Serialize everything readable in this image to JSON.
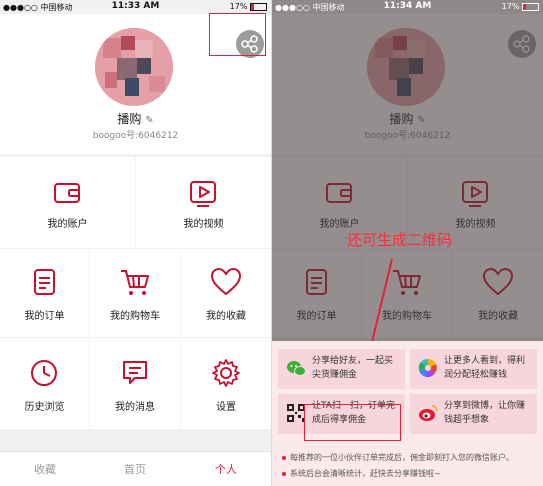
{
  "status_left": {
    "carrier": "●●●○○ 中国移动",
    "time": "11:33 AM",
    "battery": "17%"
  },
  "status_right": {
    "carrier": "●●●○○ 中国移动",
    "time": "11:34 AM",
    "battery": "17%"
  },
  "profile": {
    "nickname": "播购",
    "uid": "boogoo号:6046212"
  },
  "menu": [
    {
      "label": "我的账户",
      "icon": "wallet-icon"
    },
    {
      "label": "我的视频",
      "icon": "video-play-icon"
    },
    {
      "label": "我的订单",
      "icon": "order-document-icon"
    },
    {
      "label": "我的购物车",
      "icon": "shopping-cart-icon"
    },
    {
      "label": "我的收藏",
      "icon": "heart-icon"
    },
    {
      "label": "历史浏览",
      "icon": "clock-icon"
    },
    {
      "label": "我的消息",
      "icon": "message-icon"
    },
    {
      "label": "设置",
      "icon": "gear-icon"
    }
  ],
  "tabs": [
    {
      "label": "收藏",
      "active": false
    },
    {
      "label": "首页",
      "active": false
    },
    {
      "label": "个人",
      "active": true
    }
  ],
  "annotation": "还可生成二维码",
  "share_options": [
    {
      "text": "分享给好友，一起买尖货赚佣金",
      "icon": "wechat-icon"
    },
    {
      "text": "让更多人看到，得利润分配轻松赚钱",
      "icon": "moments-icon"
    },
    {
      "text": "让TA扫一扫，订单完成后得享佣金",
      "icon": "qrcode-icon"
    },
    {
      "text": "分享到微博，让你赚钱超乎想象",
      "icon": "weibo-icon"
    }
  ],
  "notes": [
    "每推荐的一位小伙伴订单完成后，佣金即刻打入您的微信账户。",
    "系统后台会清晰统计，赶快去分享赚钱啦~"
  ],
  "colors": {
    "accent": "#e0233b",
    "icon_stroke": "#c8102e",
    "sheet_bg": "#fbe9ec",
    "option_bg": "#f6d6dc"
  }
}
